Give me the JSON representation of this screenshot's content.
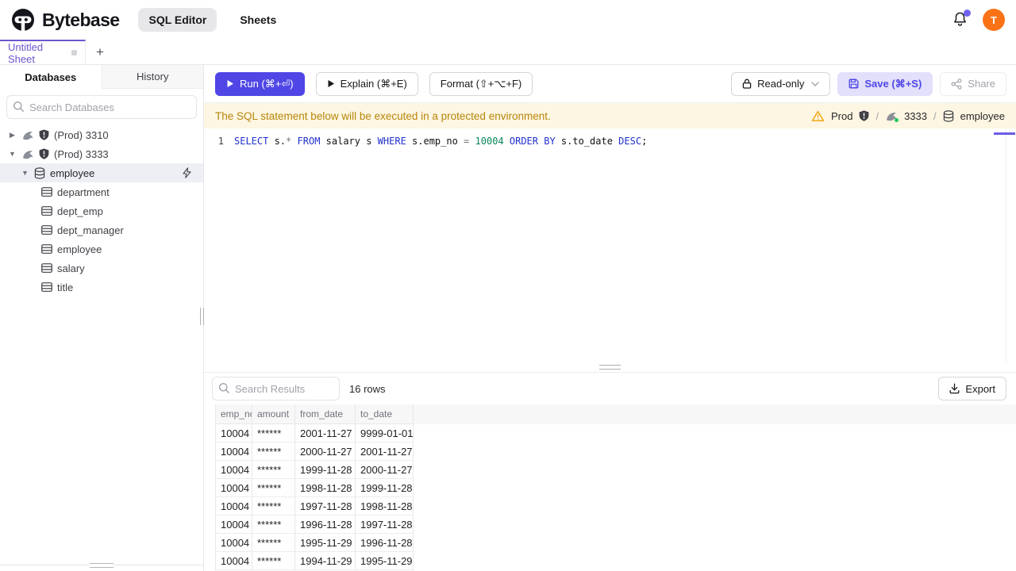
{
  "header": {
    "brand": "Bytebase",
    "nav": [
      {
        "label": "SQL Editor"
      },
      {
        "label": "Sheets"
      }
    ],
    "avatar_initial": "T"
  },
  "tabbar": {
    "active_tab": "Untitled Sheet",
    "new_tab_label": "+"
  },
  "sidebar": {
    "tabs": [
      {
        "label": "Databases"
      },
      {
        "label": "History"
      }
    ],
    "search_placeholder": "Search Databases",
    "instances": [
      {
        "label": "(Prod) 3310"
      },
      {
        "label": "(Prod) 3333"
      }
    ],
    "database_label": "employee",
    "tables": [
      "department",
      "dept_emp",
      "dept_manager",
      "employee",
      "salary",
      "title"
    ]
  },
  "toolbar": {
    "run_label": "Run (⌘+⏎)",
    "explain_label": "Explain (⌘+E)",
    "format_label": "Format (⇧+⌥+F)",
    "readonly_label": "Read-only",
    "save_label": "Save (⌘+S)",
    "share_label": "Share"
  },
  "banner": {
    "message": "The SQL statement below will be executed in a protected environment.",
    "environment": "Prod",
    "separator": "/",
    "instance": "3333",
    "database": "employee"
  },
  "editor": {
    "line_number": "1",
    "sql": "SELECT s.* FROM salary s WHERE s.emp_no = 10004 ORDER BY s.to_date DESC;",
    "tokens": [
      {
        "text": "SELECT",
        "type": "kw"
      },
      {
        "text": " s.",
        "type": "plain"
      },
      {
        "text": "*",
        "type": "op"
      },
      {
        "text": " ",
        "type": "plain"
      },
      {
        "text": "FROM",
        "type": "kw"
      },
      {
        "text": " salary s ",
        "type": "plain"
      },
      {
        "text": "WHERE",
        "type": "kw"
      },
      {
        "text": " s.emp_no ",
        "type": "plain"
      },
      {
        "text": "=",
        "type": "op"
      },
      {
        "text": " ",
        "type": "plain"
      },
      {
        "text": "10004",
        "type": "num"
      },
      {
        "text": " ",
        "type": "plain"
      },
      {
        "text": "ORDER",
        "type": "kw"
      },
      {
        "text": " ",
        "type": "plain"
      },
      {
        "text": "BY",
        "type": "kw"
      },
      {
        "text": " s.to_date ",
        "type": "plain"
      },
      {
        "text": "DESC",
        "type": "kw"
      },
      {
        "text": ";",
        "type": "plain"
      }
    ]
  },
  "results": {
    "search_placeholder": "Search Results",
    "row_count": "16 rows",
    "export_label": "Export",
    "columns": [
      "emp_no",
      "amount",
      "from_date",
      "to_date"
    ],
    "rows": [
      [
        "10004",
        "******",
        "2001-11-27",
        "9999-01-01"
      ],
      [
        "10004",
        "******",
        "2000-11-27",
        "2001-11-27"
      ],
      [
        "10004",
        "******",
        "1999-11-28",
        "2000-11-27"
      ],
      [
        "10004",
        "******",
        "1998-11-28",
        "1999-11-28"
      ],
      [
        "10004",
        "******",
        "1997-11-28",
        "1998-11-28"
      ],
      [
        "10004",
        "******",
        "1996-11-28",
        "1997-11-28"
      ],
      [
        "10004",
        "******",
        "1995-11-29",
        "1996-11-28"
      ],
      [
        "10004",
        "******",
        "1994-11-29",
        "1995-11-29"
      ]
    ]
  },
  "icons": [
    "bytebase-logo",
    "bell-icon",
    "search-icon",
    "mysql-dolphin-icon",
    "shield-icon",
    "database-icon",
    "table-icon",
    "lightning-icon",
    "play-icon",
    "lock-icon",
    "chevron-down-icon",
    "save-icon",
    "share-icon",
    "warning-icon",
    "download-icon"
  ],
  "colors": {
    "accent": "#4f46e5",
    "tab_accent": "#6e56cf",
    "avatar": "#f97316",
    "banner_bg": "#fdf6e2",
    "banner_text": "#b8860b",
    "sql_keyword": "#2031cd",
    "sql_number": "#098658",
    "status_ok": "#22c55e"
  }
}
